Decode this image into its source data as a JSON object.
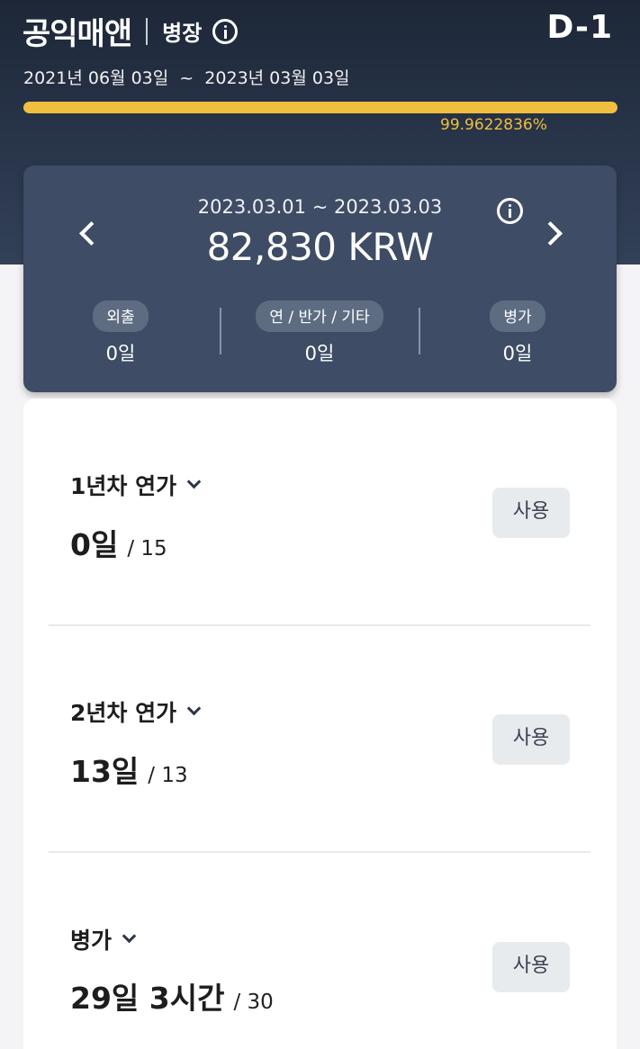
{
  "header": {
    "app_title": "공익매앤",
    "role": "병장",
    "dday": "D-1",
    "service_period": "2021년 06월 03일  ~  2023년 03월 03일",
    "progress_fraction": 0.999622836,
    "progress_text": "99.9622836%",
    "colors": {
      "background": "#1d2738",
      "progress": "#f0bf3e"
    }
  },
  "summary": {
    "period": "2023.03.01 ~ 2023.03.03",
    "amount": "82,830 KRW",
    "stats": [
      {
        "label": "외출",
        "value": "0일"
      },
      {
        "label": "연 / 반가 / 기타",
        "value": "0일"
      },
      {
        "label": "병가",
        "value": "0일"
      }
    ]
  },
  "leaves": [
    {
      "name": "1년차 연가",
      "used": "0일",
      "total": "/ 15",
      "button": "사용"
    },
    {
      "name": "2년차 연가",
      "used": "13일",
      "total": "/ 13",
      "button": "사용"
    },
    {
      "name": "병가",
      "used": "29일 3시간",
      "total": "/ 30",
      "button": "사용"
    }
  ]
}
